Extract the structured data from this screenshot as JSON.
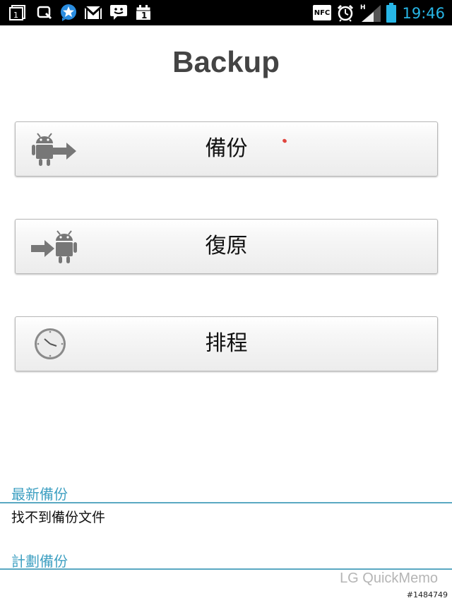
{
  "status_bar": {
    "nfc_label": "NFC",
    "network_type": "H",
    "time": "19:46",
    "notification_icons": [
      "calendar-icon",
      "search-icon",
      "star-app-icon",
      "gmail-icon",
      "chat-icon",
      "calendar-icon"
    ]
  },
  "app": {
    "title": "Backup"
  },
  "buttons": {
    "backup_label": "備份",
    "restore_label": "復原",
    "schedule_label": "排程"
  },
  "sections": {
    "latest_backup_header": "最新備份",
    "latest_backup_value": "找不到備份文件",
    "scheduled_backup_header": "計劃備份"
  },
  "overlay": {
    "watermark": "LG QuickMemo",
    "post_id": "#1484749"
  },
  "colors": {
    "accent": "#27b6e6",
    "section_header": "#3fa0c2",
    "android_gray": "#777777"
  }
}
